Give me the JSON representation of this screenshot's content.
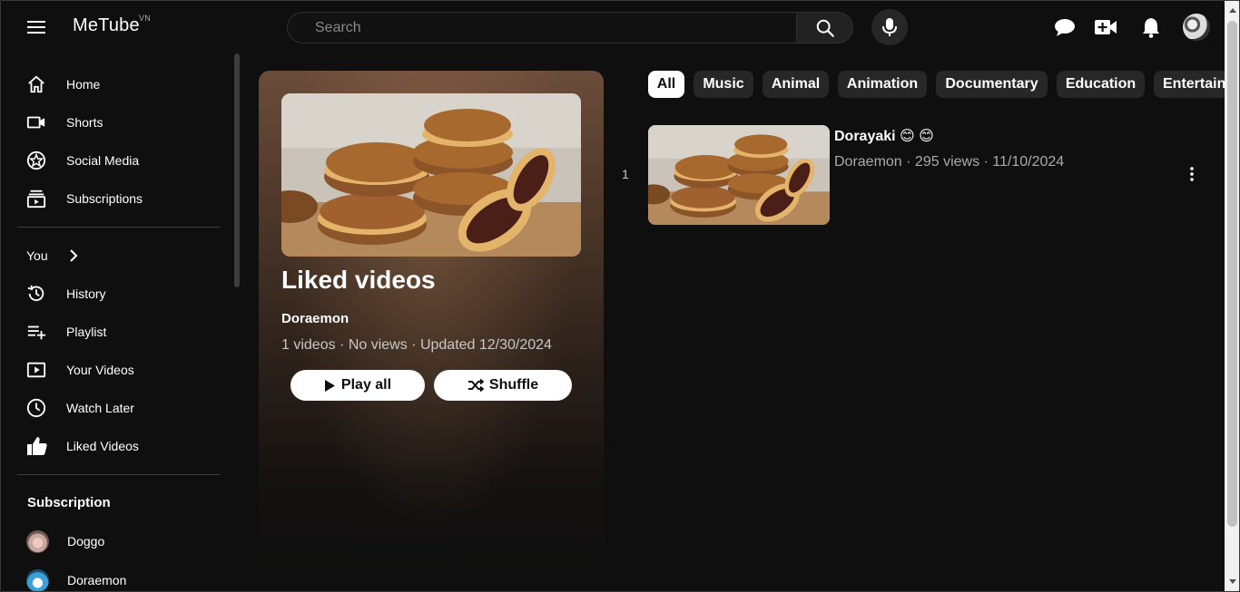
{
  "header": {
    "logo": "MeTube",
    "logo_badge": "VN",
    "search_placeholder": "Search"
  },
  "sidebar": {
    "primary": [
      {
        "label": "Home",
        "icon": "home-icon"
      },
      {
        "label": "Shorts",
        "icon": "shorts-icon"
      },
      {
        "label": "Social Media",
        "icon": "social-media-icon"
      },
      {
        "label": "Subscriptions",
        "icon": "subscriptions-icon"
      }
    ],
    "you_label": "You",
    "you_items": [
      {
        "label": "History",
        "icon": "history-icon"
      },
      {
        "label": "Playlist",
        "icon": "playlist-add-icon"
      },
      {
        "label": "Your Videos",
        "icon": "your-videos-icon"
      },
      {
        "label": "Watch Later",
        "icon": "watch-later-icon"
      },
      {
        "label": "Liked Videos",
        "icon": "thumbs-up-icon"
      }
    ],
    "subscription_title": "Subscription",
    "subscriptions": [
      {
        "name": "Doggo"
      },
      {
        "name": "Doraemon"
      }
    ]
  },
  "playlist": {
    "title": "Liked videos",
    "owner": "Doraemon",
    "meta": "1 videos · No views · Updated 12/30/2024",
    "play_all_label": "Play all",
    "shuffle_label": "Shuffle"
  },
  "chips": [
    "All",
    "Music",
    "Animal",
    "Animation",
    "Documentary",
    "Education",
    "Entertainment"
  ],
  "videos": [
    {
      "index": "1",
      "title": "Dorayaki 😊 😊",
      "meta": "Doraemon · 295 views · 11/10/2024"
    }
  ],
  "colors": {
    "background": "#0f0f0f",
    "chip": "#272727",
    "chip_active": "#ffffff",
    "text_secondary": "#aaaaaa"
  }
}
